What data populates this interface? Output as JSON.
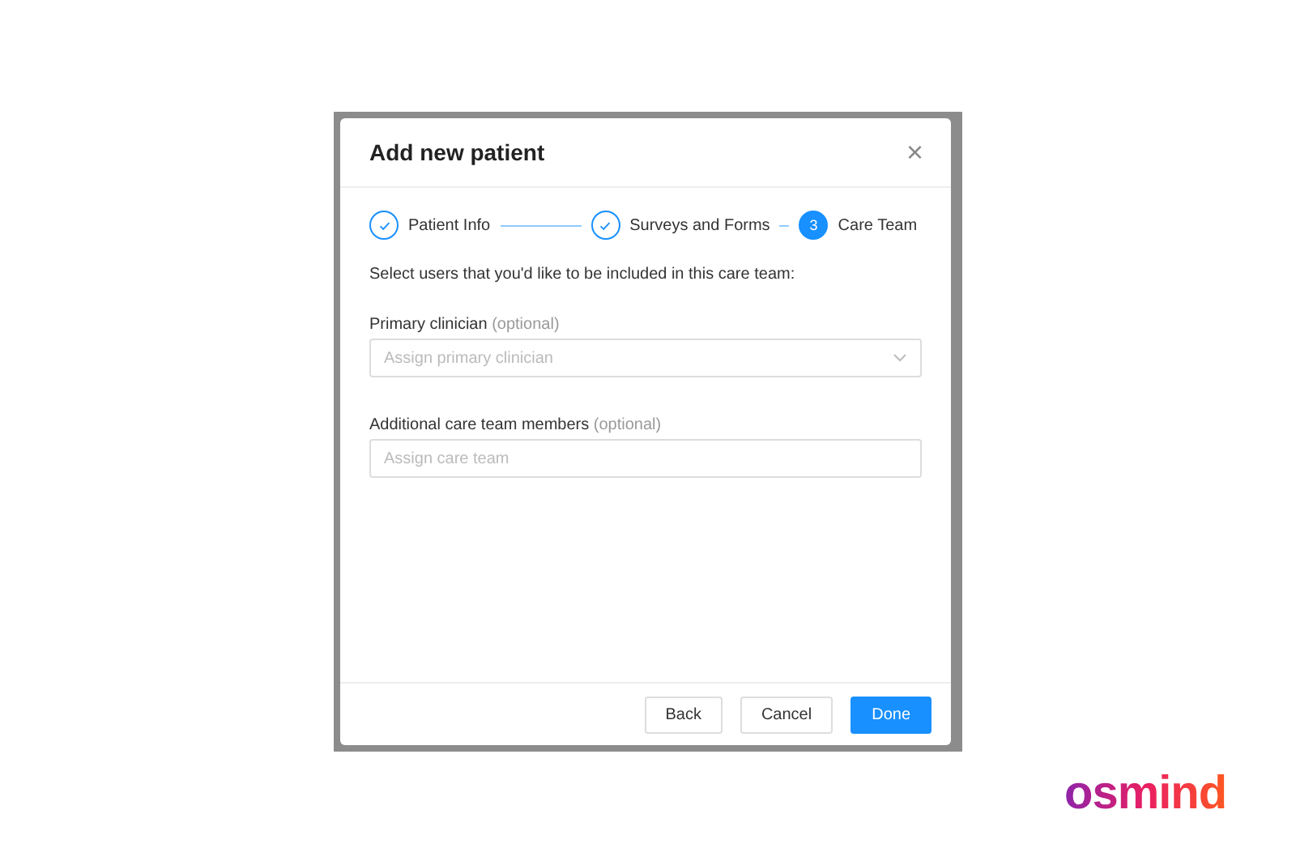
{
  "dialog": {
    "title": "Add new patient",
    "close": "×"
  },
  "steps": [
    {
      "label": "Patient Info",
      "done": true,
      "selected": false
    },
    {
      "label": "Surveys and Forms",
      "done": true,
      "selected": false
    },
    {
      "label": "Care Team",
      "done": false,
      "selected": true,
      "number": "3"
    }
  ],
  "intro": "Select users that you'd like to be included in this care team:",
  "fields": [
    {
      "kind": "select",
      "label": "Primary clinician",
      "hint": "(optional)",
      "placeholder": "Assign primary clinician"
    },
    {
      "kind": "input",
      "label": "Additional care team members",
      "hint": "(optional)",
      "placeholder": "Assign care team"
    }
  ],
  "buttons": [
    {
      "label": "Back",
      "primary": false
    },
    {
      "label": "Cancel",
      "primary": false
    },
    {
      "label": "Done",
      "primary": true
    }
  ],
  "logo": "osmind"
}
